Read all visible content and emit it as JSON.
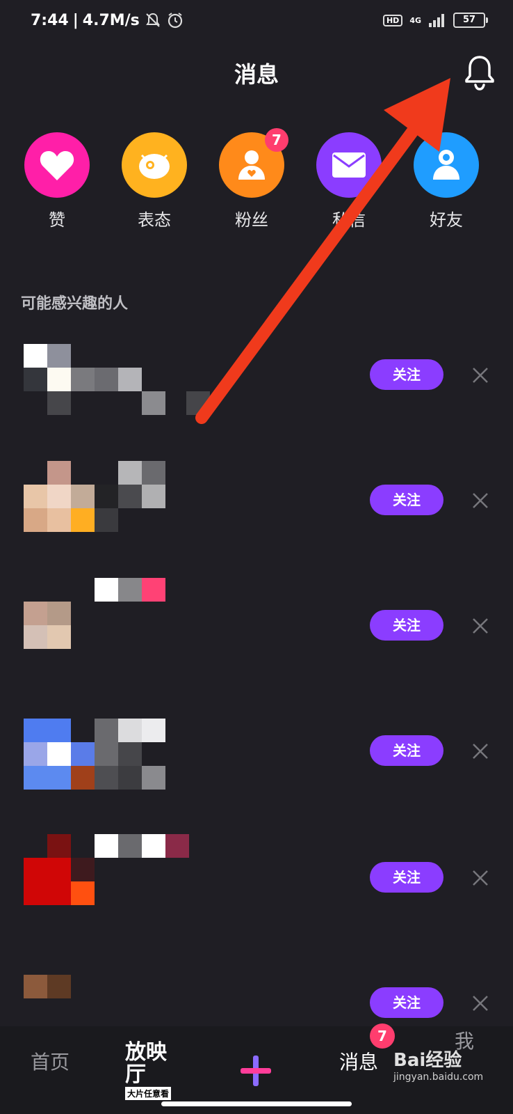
{
  "status_bar": {
    "time": "7:44",
    "speed": "4.7M/s",
    "network": "4G",
    "hd": "HD",
    "battery": "57"
  },
  "header": {
    "title": "消息"
  },
  "quick_actions": [
    {
      "label": "赞",
      "color": "#ff1fa8",
      "icon": "heart-icon"
    },
    {
      "label": "表态",
      "color": "#ffb21f",
      "icon": "fish-icon"
    },
    {
      "label": "粉丝",
      "color": "#ff8a1a",
      "icon": "fan-icon",
      "badge": "7"
    },
    {
      "label": "私信",
      "color": "#8b3dff",
      "icon": "mail-icon"
    },
    {
      "label": "好友",
      "color": "#1f9dff",
      "icon": "friend-icon"
    }
  ],
  "section": {
    "title": "可能感兴趣的人"
  },
  "suggestions": {
    "follow_label": "关注",
    "count": 6
  },
  "tabbar": {
    "home": "首页",
    "cinema_logo": "放映厅",
    "cinema_sub": "大片任意看",
    "messages": "消息",
    "messages_badge": "7",
    "me": "我",
    "watermark_text": "Bai经验",
    "watermark_url": "jingyan.baidu.com"
  },
  "colors": {
    "accent": "#8b3dff",
    "badge": "#ff3d6e",
    "annotation_arrow": "#f03a1c"
  }
}
